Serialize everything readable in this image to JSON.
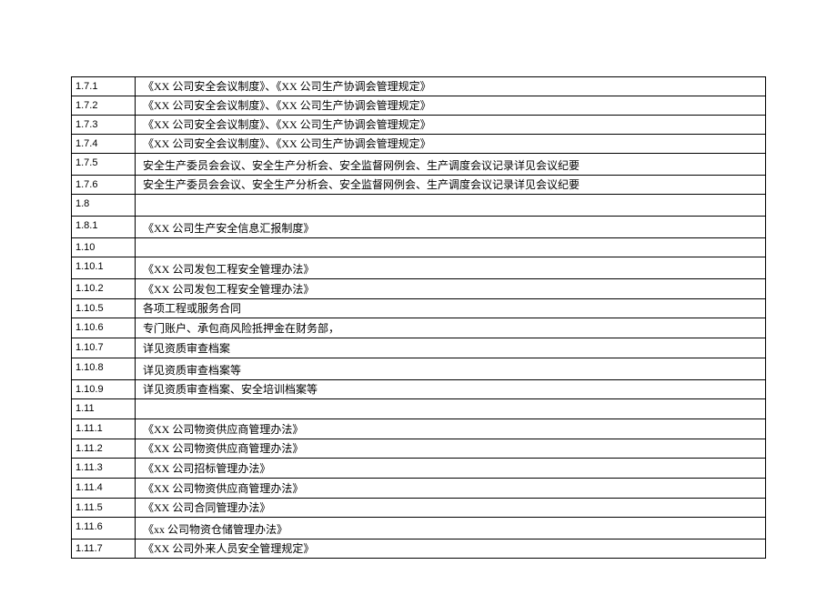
{
  "rows": [
    {
      "num": "1.7.1",
      "desc": "《XX 公司安全会议制度》、《XX 公司生产协调会管理规定》"
    },
    {
      "num": "1.7.2",
      "desc": "《XX 公司安全会议制度》、《XX 公司生产协调会管理规定》"
    },
    {
      "num": "1.7.3",
      "desc": "《XX 公司安全会议制度》、《XX 公司生产协调会管理规定》"
    },
    {
      "num": "1.7.4",
      "desc": "《XX 公司安全会议制度》、《XX 公司生产协调会管理规定》"
    },
    {
      "num": "1.7.5",
      "desc": "安全生产委员会会议、安全生产分析会、安全监督网例会、生产调度会议记录详见会议纪要",
      "tall": true
    },
    {
      "num": "1.7.6",
      "desc": "安全生产委员会会议、安全生产分析会、安全监督网例会、生产调度会议记录详见会议纪要"
    },
    {
      "num": "1.8",
      "desc": "",
      "tall": true
    },
    {
      "num": "1.8.1",
      "desc": "《XX 公司生产安全信息汇报制度》",
      "tall": true
    },
    {
      "num": "1.10",
      "desc": ""
    },
    {
      "num": "1.10.1",
      "desc": "《XX 公司发包工程安全管理办法》",
      "tall": true
    },
    {
      "num": "1.10.2",
      "desc": "《XX 公司发包工程安全管理办法》",
      "tall2": true
    },
    {
      "num": "1.10.5",
      "desc": "各项工程或服务合同"
    },
    {
      "num": "1.10.6",
      "desc": "专门账户、承包商风险抵押金在财务部，",
      "tall2": true
    },
    {
      "num": "1.10.7",
      "desc": "详见资质审查档案",
      "tall2": true
    },
    {
      "num": "1.10.8",
      "desc": "详见资质审查档案等",
      "tall": true
    },
    {
      "num": "1.10.9",
      "desc": "详见资质审查档案、安全培训档案等"
    },
    {
      "num": "1.11",
      "desc": "",
      "tall2": true
    },
    {
      "num": "1.11.1",
      "desc": "《XX 公司物资供应商管理办法》",
      "tall2": true
    },
    {
      "num": "1.11.2",
      "desc": "《XX 公司物资供应商管理办法》"
    },
    {
      "num": "1.11.3",
      "desc": "《XX 公司招标管理办法》",
      "tall2": true
    },
    {
      "num": "1.11.4",
      "desc": "《XX 公司物资供应商管理办法》",
      "tall2": true
    },
    {
      "num": "1.11.5",
      "desc": "《XX 公司合同管理办法》"
    },
    {
      "num": "1.11.6",
      "desc": "《xx 公司物资仓储管理办法》",
      "tall": true
    },
    {
      "num": "1.11.7",
      "desc": "《XX 公司外来人员安全管理规定》"
    }
  ]
}
